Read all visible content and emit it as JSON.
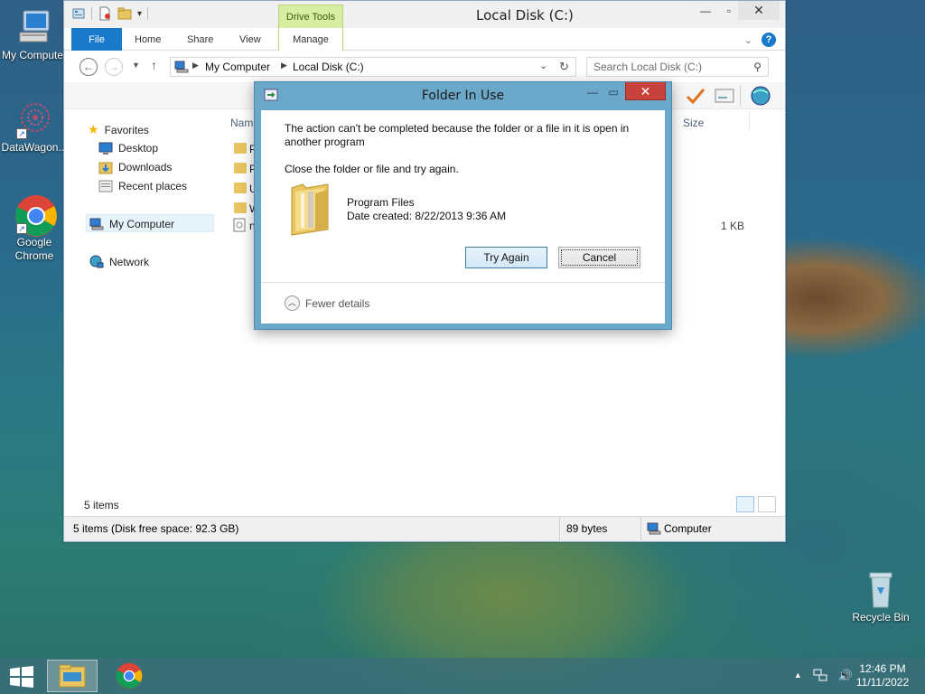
{
  "desktop": {
    "icons": [
      {
        "label": "My Computer"
      },
      {
        "label": "DataWagon..."
      },
      {
        "label": "Google Chrome"
      },
      {
        "label": "Recycle Bin"
      }
    ]
  },
  "explorer": {
    "title": "Local Disk (C:)",
    "context_tab_group": "Drive Tools",
    "tabs": [
      {
        "label": "File"
      },
      {
        "label": "Home"
      },
      {
        "label": "Share"
      },
      {
        "label": "View"
      },
      {
        "label": "Manage"
      }
    ],
    "address": {
      "crumbs": [
        "My Computer",
        "Local Disk (C:)"
      ]
    },
    "search": {
      "placeholder": "Search Local Disk (C:)"
    },
    "nav": {
      "favorites": "Favorites",
      "items": [
        "Desktop",
        "Downloads",
        "Recent places"
      ],
      "computer": "My Computer",
      "network": "Network"
    },
    "columns": {
      "name": "Name",
      "size": "Size"
    },
    "rows": [
      {
        "letter": "P"
      },
      {
        "letter": "P"
      },
      {
        "letter": "U"
      },
      {
        "letter": "W"
      },
      {
        "letter": "n",
        "size": "1 KB"
      }
    ],
    "items_count": "5 items",
    "statusbar": {
      "left": "5 items (Disk free space: 92.3 GB)",
      "mid": "89 bytes",
      "right": "Computer"
    }
  },
  "dialog": {
    "title": "Folder In Use",
    "message": "The action can't be completed because the folder or a file in it is open in another program",
    "instruction": "Close the folder or file and try again.",
    "file_name": "Program Files",
    "date_created": "Date created: 8/22/2013 9:36 AM",
    "try_again": "Try Again",
    "cancel": "Cancel",
    "details": "Fewer details"
  },
  "taskbar": {
    "time": "12:46 PM",
    "date": "11/11/2022"
  },
  "colors": {
    "accent": "#1979ca",
    "dialog_frame": "#6aa7c9",
    "close_red": "#c7423a",
    "drive_tools": "#d5eea0"
  }
}
